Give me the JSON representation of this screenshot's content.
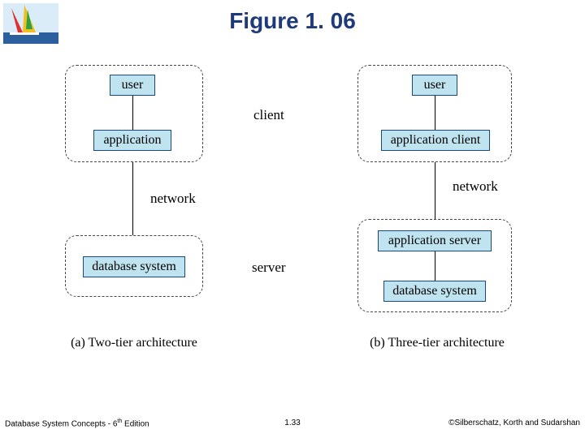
{
  "title": "Figure 1. 06",
  "labels": {
    "client": "client",
    "network_a": "network",
    "network_b": "network",
    "server": "server"
  },
  "left": {
    "user": "user",
    "application": "application",
    "database": "database system",
    "caption": "(a) Two-tier architecture"
  },
  "right": {
    "user": "user",
    "appclient": "application client",
    "appserver": "application server",
    "database": "database system",
    "caption": "(b) Three-tier architecture"
  },
  "footer": {
    "left_a": "Database System Concepts - 6",
    "left_sup": "th",
    "left_b": " Edition",
    "center": "1.33",
    "right": "©Silberschatz, Korth and Sudarshan"
  }
}
